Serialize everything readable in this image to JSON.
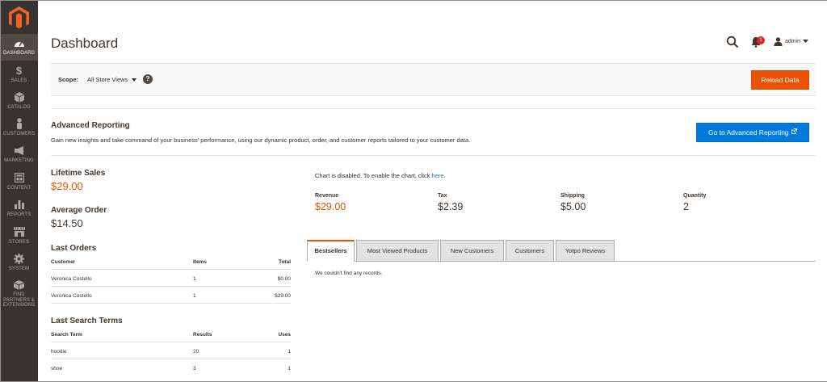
{
  "sidebar": {
    "items": [
      {
        "label": "DASHBOARD",
        "icon": "dashboard-icon"
      },
      {
        "label": "SALES",
        "icon": "dollar-icon"
      },
      {
        "label": "CATALOG",
        "icon": "cube-icon"
      },
      {
        "label": "CUSTOMERS",
        "icon": "person-icon"
      },
      {
        "label": "MARKETING",
        "icon": "megaphone-icon"
      },
      {
        "label": "CONTENT",
        "icon": "layout-icon"
      },
      {
        "label": "REPORTS",
        "icon": "bar-chart-icon"
      },
      {
        "label": "STORES",
        "icon": "storefront-icon"
      },
      {
        "label": "SYSTEM",
        "icon": "gear-icon"
      },
      {
        "label": "FIND PARTNERS & EXTENSIONS",
        "icon": "box-icon"
      }
    ]
  },
  "header": {
    "title": "Dashboard",
    "notifications_count": "1",
    "user": "admin"
  },
  "scope": {
    "label": "Scope:",
    "value": "All Store Views",
    "help": "?",
    "reload_label": "Reload Data"
  },
  "advanced_reporting": {
    "title": "Advanced Reporting",
    "description": "Gain new insights and take command of your business' performance, using our dynamic product, order, and customer reports tailored to your customer data.",
    "button_label": "Go to Advanced Reporting"
  },
  "stats": {
    "lifetime_sales_label": "Lifetime Sales",
    "lifetime_sales_value": "$29.00",
    "average_order_label": "Average Order",
    "average_order_value": "$14.50"
  },
  "last_orders": {
    "title": "Last Orders",
    "columns": [
      "Customer",
      "Items",
      "Total"
    ],
    "rows": [
      {
        "customer": "Veronica Costello",
        "items": "1",
        "total": "$0.00"
      },
      {
        "customer": "Veronica Costello",
        "items": "1",
        "total": "$29.00"
      }
    ]
  },
  "last_search_terms": {
    "title": "Last Search Terms",
    "columns": [
      "Search Term",
      "Results",
      "Uses"
    ],
    "rows": [
      {
        "term": "hoodie",
        "results": "20",
        "uses": "1"
      },
      {
        "term": "shoe",
        "results": "3",
        "uses": "1"
      }
    ]
  },
  "chart": {
    "note": "Chart is disabled. To enable the chart, click ",
    "link": "here",
    "note_end": "."
  },
  "totals": {
    "revenue_label": "Revenue",
    "revenue_value": "$29.00",
    "tax_label": "Tax",
    "tax_value": "$2.39",
    "shipping_label": "Shipping",
    "shipping_value": "$5.00",
    "quantity_label": "Quantity",
    "quantity_value": "2"
  },
  "tabs": {
    "items": [
      "Bestsellers",
      "Most Viewed Products",
      "New Customers",
      "Customers",
      "Yotpo Reviews"
    ],
    "active": "Bestsellers",
    "empty_message": "We couldn't find any records."
  },
  "colors": {
    "sidebar_bg": "#373330",
    "accent_orange": "#eb5202",
    "link_blue": "#007bdb"
  }
}
